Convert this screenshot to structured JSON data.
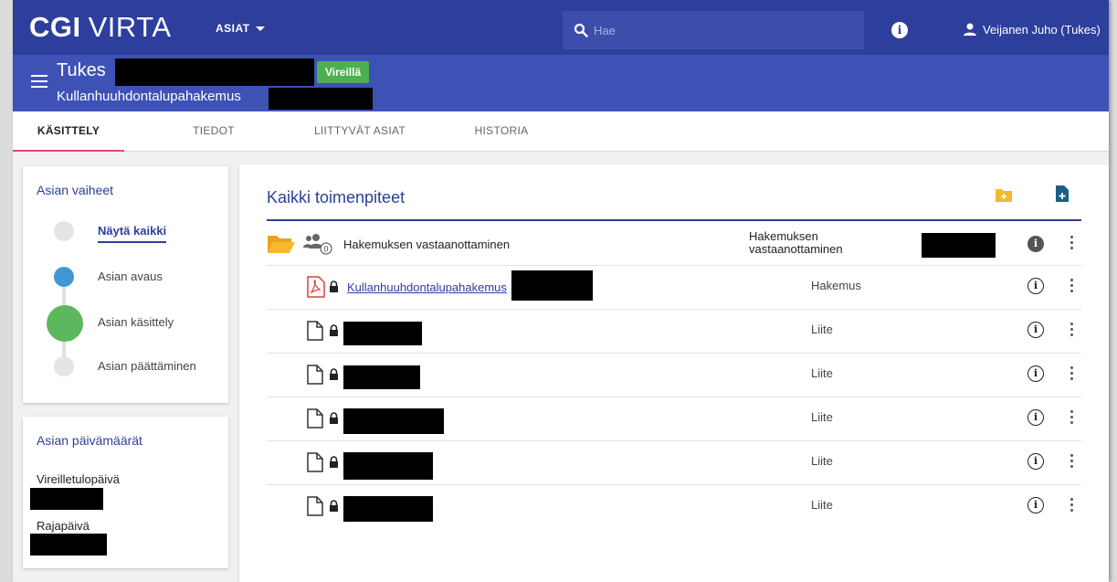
{
  "topbar": {
    "logo_cgi": "CGI",
    "logo_virta": "VIRTA",
    "menu_label": "ASIAT",
    "search_placeholder": "Hae",
    "user_name": "Veijanen Juho (Tukes)"
  },
  "case": {
    "org": "Tukes",
    "status": "Vireillä",
    "type": "Kullanhuuhdontalupahakemus"
  },
  "tabs": [
    {
      "label": "KÄSITTELY"
    },
    {
      "label": "TIEDOT"
    },
    {
      "label": "LIITTYVÄT ASIAT"
    },
    {
      "label": "HISTORIA"
    }
  ],
  "phases": {
    "title": "Asian vaiheet",
    "items": [
      {
        "label": "Näytä kaikki"
      },
      {
        "label": "Asian avaus"
      },
      {
        "label": "Asian käsittely"
      },
      {
        "label": "Asian päättäminen"
      }
    ]
  },
  "dates": {
    "title": "Asian päivämäärät",
    "fields": [
      {
        "label": "Vireilletulopäivä"
      },
      {
        "label": "Rajapäivä"
      }
    ]
  },
  "main": {
    "title": "Kaikki toimenpiteet",
    "folder_row": {
      "name": "Hakemuksen vastaanottaminen",
      "type_line1": "Hakemuksen",
      "type_line2": "vastaanottaminen",
      "participants_count": "0"
    },
    "documents": [
      {
        "name": "Kullanhuuhdontalupahakemus",
        "type": "Hakemus",
        "file_kind": "pdf"
      },
      {
        "name": "",
        "type": "Liite",
        "file_kind": "file"
      },
      {
        "name": "",
        "type": "Liite",
        "file_kind": "file"
      },
      {
        "name": "",
        "type": "Liite",
        "file_kind": "file"
      },
      {
        "name": "",
        "type": "Liite",
        "file_kind": "file"
      },
      {
        "name": "",
        "type": "Liite",
        "file_kind": "file"
      }
    ]
  },
  "colors": {
    "topbar": "#2d3e9c",
    "casebar": "#3e52b5",
    "status_green": "#4caf50",
    "active_tab_underline": "#e8457d",
    "phase_done": "#3f97d8",
    "phase_current": "#5cb85c",
    "folder_yellow": "#f5b82e",
    "pdf_red": "#d9433b"
  },
  "icons": [
    "search-icon",
    "info-icon",
    "user-icon",
    "menu-icon",
    "folder-open-icon",
    "group-icon",
    "pdf-icon",
    "file-icon",
    "lock-icon",
    "new-folder-icon",
    "new-document-icon",
    "more-icon"
  ]
}
